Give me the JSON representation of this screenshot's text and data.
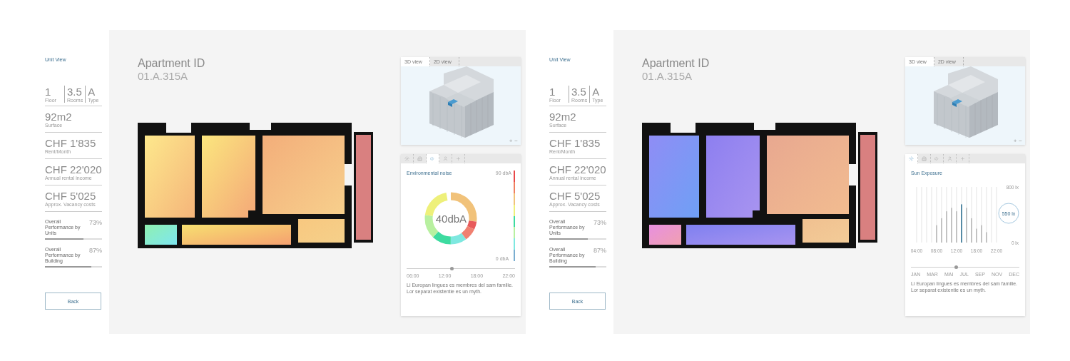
{
  "screens": [
    {
      "sidebar": {
        "heading": "Unit View",
        "quick_facts": [
          {
            "value": "1",
            "label": "Floor"
          },
          {
            "value": "3.5",
            "label": "Rooms"
          },
          {
            "value": "A",
            "label": "Type"
          }
        ],
        "figures": [
          {
            "value": "92m2",
            "label": "Surface"
          },
          {
            "value": "CHF 1'835",
            "label": "Rent/Month"
          },
          {
            "value": "CHF 22'020",
            "label": "Annual rental income"
          },
          {
            "value": "CHF 5'025",
            "label": "Approx. Vacancy costs"
          }
        ],
        "performance": [
          {
            "label": "Overall Performance by Units",
            "reading": "73%",
            "level": 0.67
          },
          {
            "label": "Overall Performance by Building",
            "reading": "87%",
            "level": 0.81
          }
        ],
        "back_button": "Back"
      },
      "title": "Apartment ID",
      "subtitle": "01.A.315A",
      "floor_plan": {
        "kind": "noise"
      },
      "view_card": {
        "tabs": [
          {
            "label": "3D view",
            "selected": true
          },
          {
            "label": "2D view",
            "selected": false
          }
        ],
        "zoom_controls": [
          "+",
          "−"
        ]
      },
      "analysis_card": {
        "kind": "noise",
        "tabs": [
          {
            "selected": false
          },
          {
            "selected": false
          },
          {
            "selected": true
          },
          {
            "selected": false
          },
          {
            "selected": false
          }
        ],
        "title": "Environmental noise",
        "scale_max": "90 dbA",
        "scale_min": "0 dbA",
        "center_value": "40dbA",
        "slider": {
          "level": 0.42,
          "labels": [
            "06:00",
            "12:00",
            "18:00",
            "22:00"
          ]
        },
        "description": "Li Europan lingues es membres del sam familie. Lor separat existentie es un myth."
      }
    },
    {
      "sidebar": {
        "heading": "Unit View",
        "quick_facts": [
          {
            "value": "1",
            "label": "Floor"
          },
          {
            "value": "3.5",
            "label": "Rooms"
          },
          {
            "value": "A",
            "label": "Type"
          }
        ],
        "figures": [
          {
            "value": "92m2",
            "label": "Surface"
          },
          {
            "value": "CHF 1'835",
            "label": "Rent/Month"
          },
          {
            "value": "CHF 22'020",
            "label": "Annual rental income"
          },
          {
            "value": "CHF 5'025",
            "label": "Approx. Vacancy costs"
          }
        ],
        "performance": [
          {
            "label": "Overall Performance by Units",
            "reading": "73%",
            "level": 0.67
          },
          {
            "label": "Overall Performance by Building",
            "reading": "87%",
            "level": 0.81
          }
        ],
        "back_button": "Back"
      },
      "title": "Apartment ID",
      "subtitle": "01.A.315A",
      "floor_plan": {
        "kind": "sun"
      },
      "view_card": {
        "tabs": [
          {
            "label": "3D view",
            "selected": true
          },
          {
            "label": "2D view",
            "selected": false
          }
        ],
        "zoom_controls": [
          "+",
          "−"
        ]
      },
      "analysis_card": {
        "kind": "sun",
        "tabs": [
          {
            "selected": true
          },
          {
            "selected": false
          },
          {
            "selected": false
          },
          {
            "selected": false
          },
          {
            "selected": false
          }
        ],
        "title": "Sun Exposure",
        "chart_data": {
          "type": "bar",
          "ylim": [
            0,
            800
          ],
          "yticks": [
            {
              "value": 0,
              "label": "0 lx"
            },
            {
              "value": 800,
              "label": "800 lx"
            }
          ],
          "categories": [
            "04:00",
            null,
            null,
            null,
            "08:00",
            null,
            null,
            null,
            "12:00",
            null,
            null,
            null,
            "18:00",
            null,
            null,
            null,
            "22:00"
          ],
          "values": [
            0,
            0,
            0,
            0,
            250,
            350,
            450,
            500,
            450,
            550,
            500,
            350,
            200,
            250,
            150,
            0,
            0
          ],
          "grid": true,
          "annotations": [
            "550 lx"
          ]
        },
        "slider": {
          "level": 0.42,
          "labels": [
            "JAN",
            "MAR",
            "MAI",
            "JUL",
            "SEP",
            "NOV",
            "DEC"
          ]
        },
        "description": "Li Europan lingues es membres del sam familie. Lor separat existentie es un myth."
      }
    }
  ]
}
